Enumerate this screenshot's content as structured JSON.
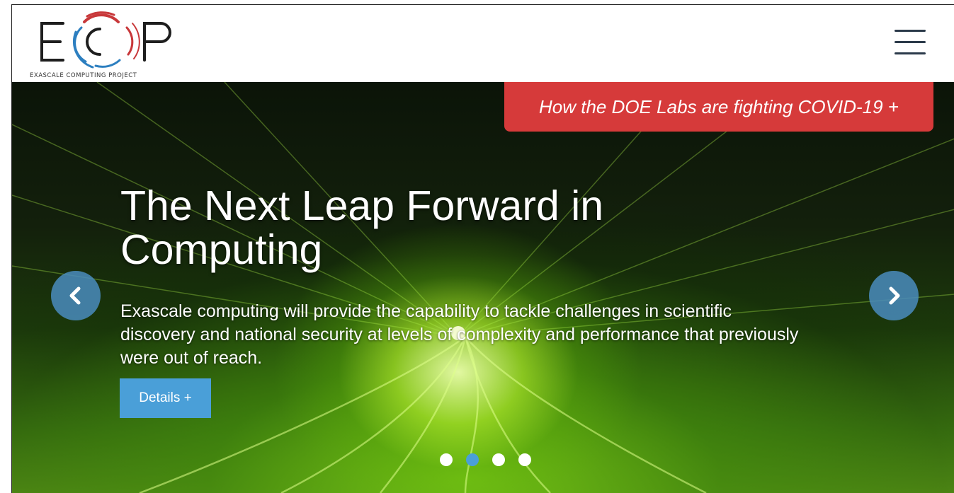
{
  "brand": {
    "logo_text": "ECP",
    "tagline": "EXASCALE COMPUTING PROJECT"
  },
  "navbar": {
    "menu_icon": "hamburger-menu-icon"
  },
  "banner": {
    "text": "How the DOE Labs are fighting COVID-19 +"
  },
  "hero": {
    "headline": "The Next Leap Forward in Computing",
    "description": "Exascale computing will provide the capability to tackle challenges in scientific discovery and national security at levels of complexity and performance that previously were out of reach.",
    "details_button": "Details +",
    "prev_icon": "chevron-left-icon",
    "next_icon": "chevron-right-icon",
    "slide_count": 4,
    "active_slide": 2
  },
  "colors": {
    "banner_red": "#d63a3a",
    "button_blue": "#4a9fd8",
    "arrow_blue": "#4a8cbe",
    "dot_active": "#4a9fd8",
    "dot_inactive": "#ffffff",
    "logo_red": "#c8383a",
    "logo_blue": "#2d7fc0",
    "logo_dark": "#1e1e1e"
  }
}
